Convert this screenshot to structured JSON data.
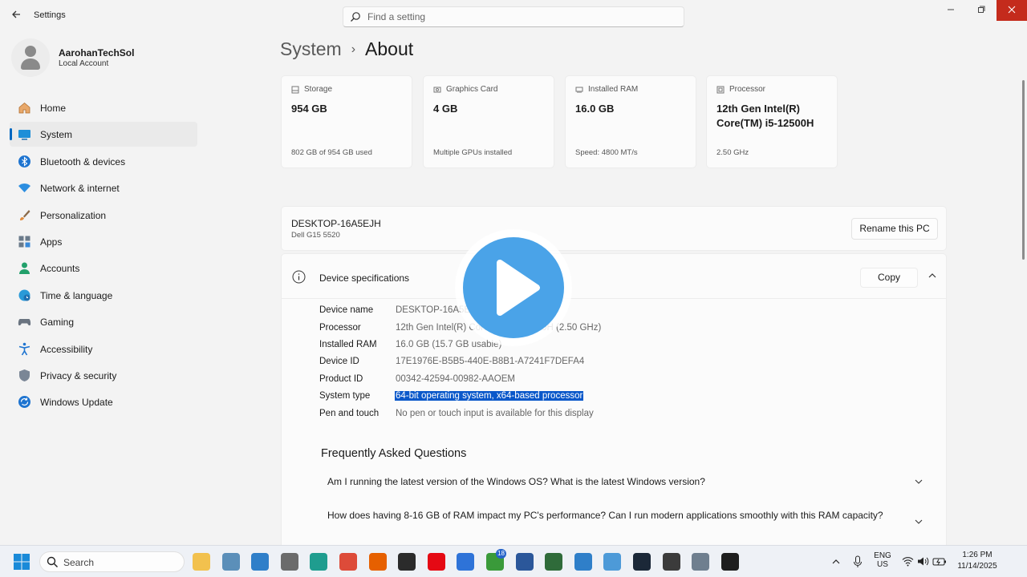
{
  "window": {
    "title": "Settings",
    "search_placeholder": "Find a setting"
  },
  "profile": {
    "name": "AarohanTechSol",
    "account_type": "Local Account"
  },
  "sidebar": {
    "items": [
      {
        "label": "Home",
        "icon": "home-icon",
        "active": false
      },
      {
        "label": "System",
        "icon": "system-icon",
        "active": true
      },
      {
        "label": "Bluetooth & devices",
        "icon": "bluetooth-icon",
        "active": false
      },
      {
        "label": "Network & internet",
        "icon": "network-icon",
        "active": false
      },
      {
        "label": "Personalization",
        "icon": "paintbrush-icon",
        "active": false
      },
      {
        "label": "Apps",
        "icon": "apps-icon",
        "active": false
      },
      {
        "label": "Accounts",
        "icon": "accounts-icon",
        "active": false
      },
      {
        "label": "Time & language",
        "icon": "globe-clock-icon",
        "active": false
      },
      {
        "label": "Gaming",
        "icon": "gamepad-icon",
        "active": false
      },
      {
        "label": "Accessibility",
        "icon": "accessibility-icon",
        "active": false
      },
      {
        "label": "Privacy & security",
        "icon": "shield-icon",
        "active": false
      },
      {
        "label": "Windows Update",
        "icon": "update-icon",
        "active": false
      }
    ]
  },
  "breadcrumb": {
    "parent": "System",
    "current": "About"
  },
  "cards": [
    {
      "title": "Storage",
      "value": "954 GB",
      "sub": "802 GB of 954 GB used",
      "icon": "storage-icon"
    },
    {
      "title": "Graphics Card",
      "value": "4 GB",
      "sub": "Multiple GPUs installed",
      "icon": "gpu-icon"
    },
    {
      "title": "Installed RAM",
      "value": "16.0 GB",
      "sub": "Speed: 4800 MT/s",
      "icon": "ram-icon"
    },
    {
      "title": "Processor",
      "value": "12th Gen Intel(R) Core(TM) i5-12500H",
      "sub": "2.50 GHz",
      "icon": "processor-icon"
    }
  ],
  "pc": {
    "name": "DESKTOP-16A5EJH",
    "model": "Dell G15 5520",
    "rename_label": "Rename this PC"
  },
  "specs": {
    "title": "Device specifications",
    "copy_label": "Copy",
    "rows": [
      {
        "key": "Device name",
        "value": "DESKTOP-16A5EJH"
      },
      {
        "key": "Processor",
        "value": "12th Gen Intel(R) Core(TM) i5-12500H (2.50 GHz)"
      },
      {
        "key": "Installed RAM",
        "value": "16.0 GB (15.7 GB usable)"
      },
      {
        "key": "Device ID",
        "value": "17E1976E-B5B5-440E-B8B1-A7241F7DEFA4"
      },
      {
        "key": "Product ID",
        "value": "00342-42594-00982-AAOEM"
      },
      {
        "key": "System type",
        "value": "64-bit operating system, x64-based processor",
        "selected": true
      },
      {
        "key": "Pen and touch",
        "value": "No pen or touch input is available for this display"
      }
    ]
  },
  "faq": {
    "title": "Frequently Asked Questions",
    "items": [
      "Am I running the latest version of the Windows OS? What is the latest Windows version?",
      "How does having 8-16 GB of RAM impact my PC's performance? Can I run modern applications smoothly with this RAM capacity?"
    ]
  },
  "taskbar": {
    "search_label": "Search",
    "apps": [
      {
        "name": "file-explorer-icon",
        "color": "#f2c14e"
      },
      {
        "name": "files-app-icon",
        "color": "#5b8fb9"
      },
      {
        "name": "photos-icon",
        "color": "#2f7fc9"
      },
      {
        "name": "calculator-icon",
        "color": "#6b6b6b"
      },
      {
        "name": "edge-icon",
        "color": "#1f9d8f"
      },
      {
        "name": "chrome-icon",
        "color": "#dd4b39"
      },
      {
        "name": "firefox-icon",
        "color": "#e66000"
      },
      {
        "name": "obs-icon",
        "color": "#2b2b2b"
      },
      {
        "name": "netflix-icon",
        "color": "#e50914"
      },
      {
        "name": "store-icon",
        "color": "#2e73d8"
      },
      {
        "name": "xbox-icon",
        "color": "#3a9a3a",
        "badge": "18"
      },
      {
        "name": "word-icon",
        "color": "#2b579a"
      },
      {
        "name": "cube-app-icon",
        "color": "#2f6b3a"
      },
      {
        "name": "browser-app-icon",
        "color": "#2f7fc9"
      },
      {
        "name": "paint-app-icon",
        "color": "#4d9ad8"
      },
      {
        "name": "steam-icon",
        "color": "#1b2838"
      },
      {
        "name": "nvidia-app-icon",
        "color": "#3b3b3b"
      },
      {
        "name": "settings-icon",
        "color": "#6f7f8f"
      },
      {
        "name": "terminal-icon",
        "color": "#1e1e1e"
      }
    ],
    "language": "ENG",
    "region": "US",
    "time": "1:26 PM",
    "date": "11/14/2025"
  }
}
